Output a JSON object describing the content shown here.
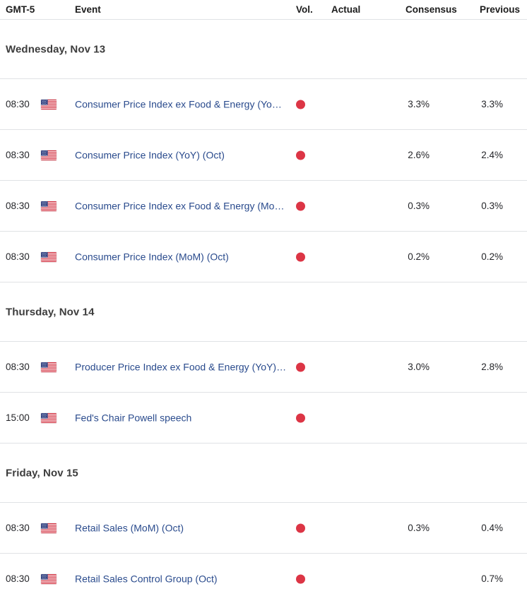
{
  "header": {
    "timezone": "GMT-5",
    "event": "Event",
    "volatility": "Vol.",
    "actual": "Actual",
    "consensus": "Consensus",
    "previous": "Previous"
  },
  "colors": {
    "link": "#2a4b8d",
    "volatility_high": "#dc3545",
    "divider": "#e0e2e5",
    "date_header": "#3c3c3c"
  },
  "groups": [
    {
      "date": "Wednesday, Nov 13",
      "rows": [
        {
          "time": "08:30",
          "country": "flag-us-icon",
          "event": "Consumer Price Index ex Food & Energy (Yo…",
          "volatility": "high",
          "actual": "",
          "consensus": "3.3%",
          "previous": "3.3%"
        },
        {
          "time": "08:30",
          "country": "flag-us-icon",
          "event": "Consumer Price Index (YoY) (Oct)",
          "volatility": "high",
          "actual": "",
          "consensus": "2.6%",
          "previous": "2.4%"
        },
        {
          "time": "08:30",
          "country": "flag-us-icon",
          "event": "Consumer Price Index ex Food & Energy (Mo…",
          "volatility": "high",
          "actual": "",
          "consensus": "0.3%",
          "previous": "0.3%"
        },
        {
          "time": "08:30",
          "country": "flag-us-icon",
          "event": "Consumer Price Index (MoM) (Oct)",
          "volatility": "high",
          "actual": "",
          "consensus": "0.2%",
          "previous": "0.2%"
        }
      ]
    },
    {
      "date": "Thursday, Nov 14",
      "rows": [
        {
          "time": "08:30",
          "country": "flag-us-icon",
          "event": "Producer Price Index ex Food & Energy (YoY)…",
          "volatility": "high",
          "actual": "",
          "consensus": "3.0%",
          "previous": "2.8%"
        },
        {
          "time": "15:00",
          "country": "flag-us-icon",
          "event": "Fed's Chair Powell speech",
          "volatility": "high",
          "actual": "",
          "consensus": "",
          "previous": ""
        }
      ]
    },
    {
      "date": "Friday, Nov 15",
      "rows": [
        {
          "time": "08:30",
          "country": "flag-us-icon",
          "event": "Retail Sales (MoM) (Oct)",
          "volatility": "high",
          "actual": "",
          "consensus": "0.3%",
          "previous": "0.4%"
        },
        {
          "time": "08:30",
          "country": "flag-us-icon",
          "event": "Retail Sales Control Group (Oct)",
          "volatility": "high",
          "actual": "",
          "consensus": "",
          "previous": "0.7%"
        }
      ]
    }
  ]
}
